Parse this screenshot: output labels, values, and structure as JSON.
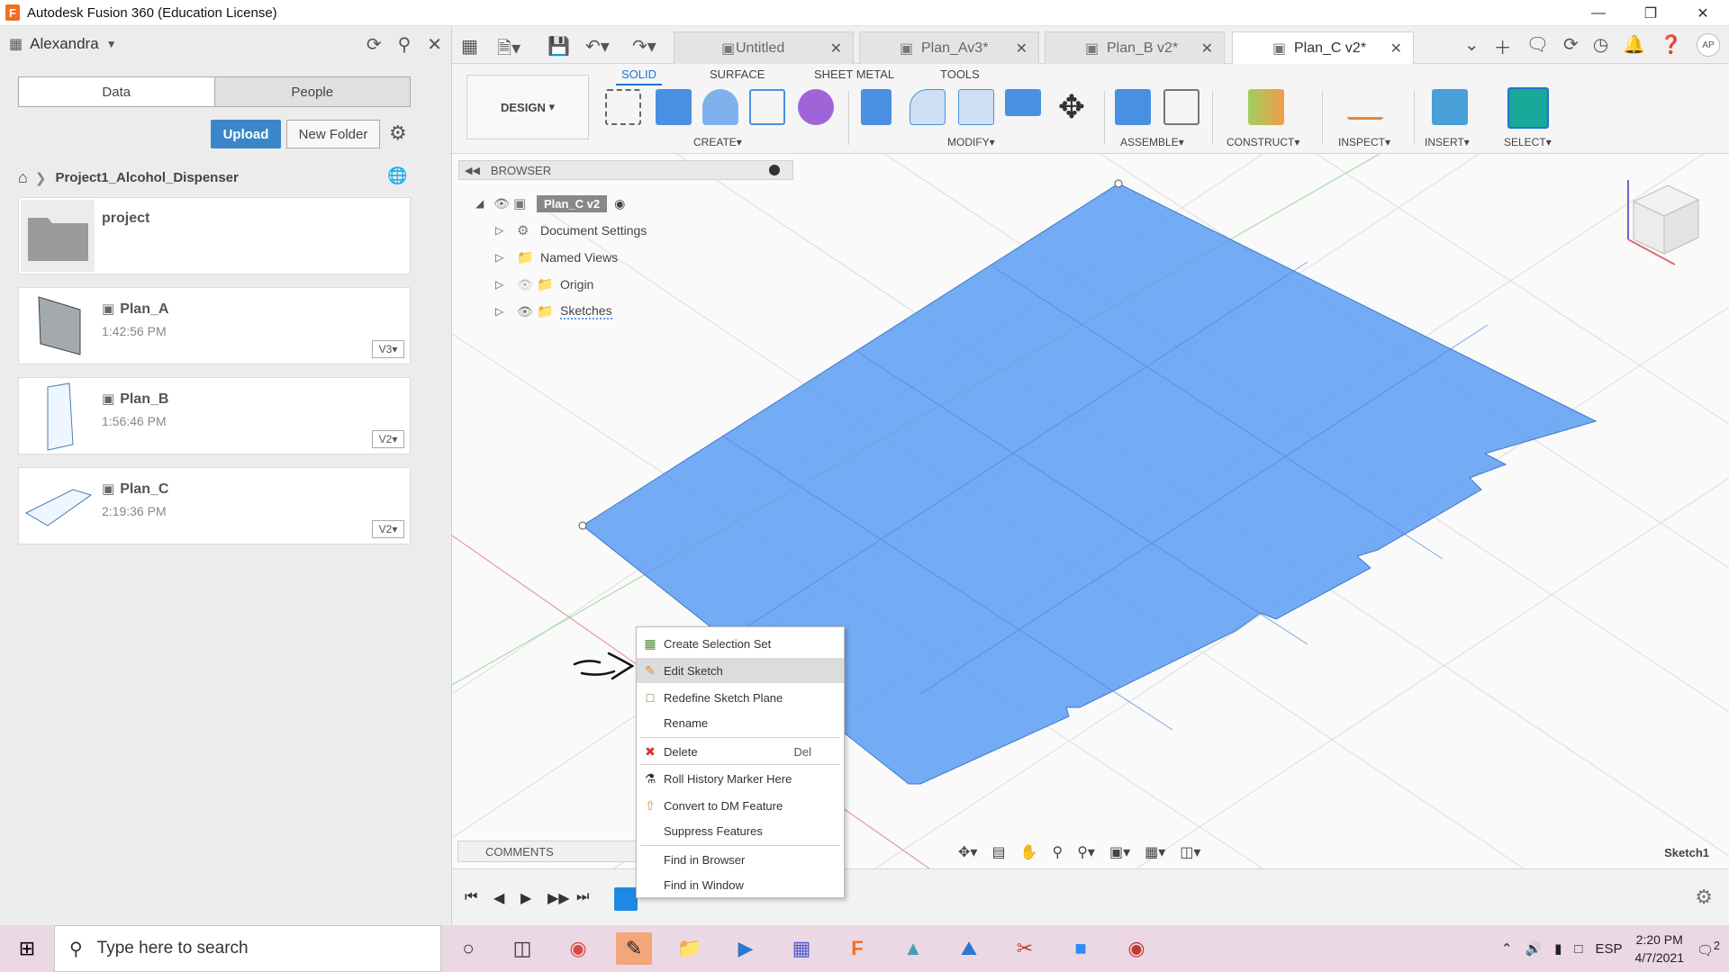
{
  "window": {
    "title": "Autodesk Fusion 360 (Education License)"
  },
  "datapanel": {
    "username": "Alexandra",
    "tabs": [
      "Data",
      "People"
    ],
    "upload_label": "Upload",
    "newfolder_label": "New Folder",
    "breadcrumb": "Project1_Alcohol_Dispenser",
    "folder": {
      "name": "project"
    },
    "files": [
      {
        "name": "Plan_A",
        "time": "1:42:56 PM",
        "version": "V3"
      },
      {
        "name": "Plan_B",
        "time": "1:56:46 PM",
        "version": "V2"
      },
      {
        "name": "Plan_C",
        "time": "2:19:36 PM",
        "version": "V2"
      }
    ]
  },
  "doctabs": [
    {
      "name": "Untitled",
      "active": false
    },
    {
      "name": "Plan_Av3*",
      "active": false
    },
    {
      "name": "Plan_B v2*",
      "active": false
    },
    {
      "name": "Plan_C v2*",
      "active": true
    }
  ],
  "user_initials": "AP",
  "ribbon": {
    "design_label": "DESIGN",
    "tabs": [
      "SOLID",
      "SURFACE",
      "SHEET METAL",
      "TOOLS"
    ],
    "groups": [
      "CREATE",
      "MODIFY",
      "ASSEMBLE",
      "CONSTRUCT",
      "INSPECT",
      "INSERT",
      "SELECT"
    ]
  },
  "browser": {
    "title": "BROWSER",
    "root": "Plan_C v2",
    "items": [
      "Document Settings",
      "Named Views",
      "Origin",
      "Sketches"
    ]
  },
  "comments_label": "COMMENTS",
  "sketch_label": "Sketch1",
  "context_menu": [
    {
      "label": "Create Selection Set",
      "key": ""
    },
    {
      "label": "Edit Sketch",
      "key": ""
    },
    {
      "label": "Redefine Sketch Plane",
      "key": ""
    },
    {
      "label": "Rename",
      "key": ""
    },
    {
      "label": "Delete",
      "key": "Del"
    },
    {
      "label": "Roll History Marker Here",
      "key": ""
    },
    {
      "label": "Convert to DM Feature",
      "key": ""
    },
    {
      "label": "Suppress Features",
      "key": ""
    },
    {
      "label": "Find in Browser",
      "key": ""
    },
    {
      "label": "Find in Window",
      "key": ""
    }
  ],
  "taskbar": {
    "search_placeholder": "Type here to search",
    "language": "ESP",
    "time": "2:20 PM",
    "date": "4/7/2021",
    "notifications": "2"
  },
  "colors": {
    "accent": "#1976d2",
    "sketch_fill": "#5b9cf2",
    "upload": "#3b86c9"
  }
}
